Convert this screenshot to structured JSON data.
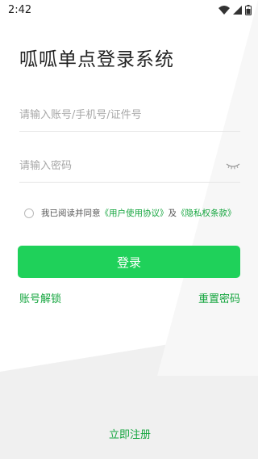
{
  "status_bar": {
    "time": "2:42",
    "icons": [
      "wifi-icon",
      "signal-icon",
      "battery-icon"
    ]
  },
  "app": {
    "title": "呱呱单点登录系统"
  },
  "form": {
    "account_placeholder": "请输入账号/手机号/证件号",
    "password_placeholder": "请输入密码"
  },
  "agreement": {
    "prefix": "我已阅读并同意",
    "user_agreement": "《用户使用协议》",
    "and": "及",
    "privacy": "《隐私权条款》"
  },
  "buttons": {
    "login": "登录",
    "unlock_account": "账号解锁",
    "reset_password": "重置密码",
    "register": "立即注册"
  },
  "colors": {
    "primary": "#1fd15a",
    "link": "#14a53e",
    "background_shape": "#f0f0f0"
  }
}
